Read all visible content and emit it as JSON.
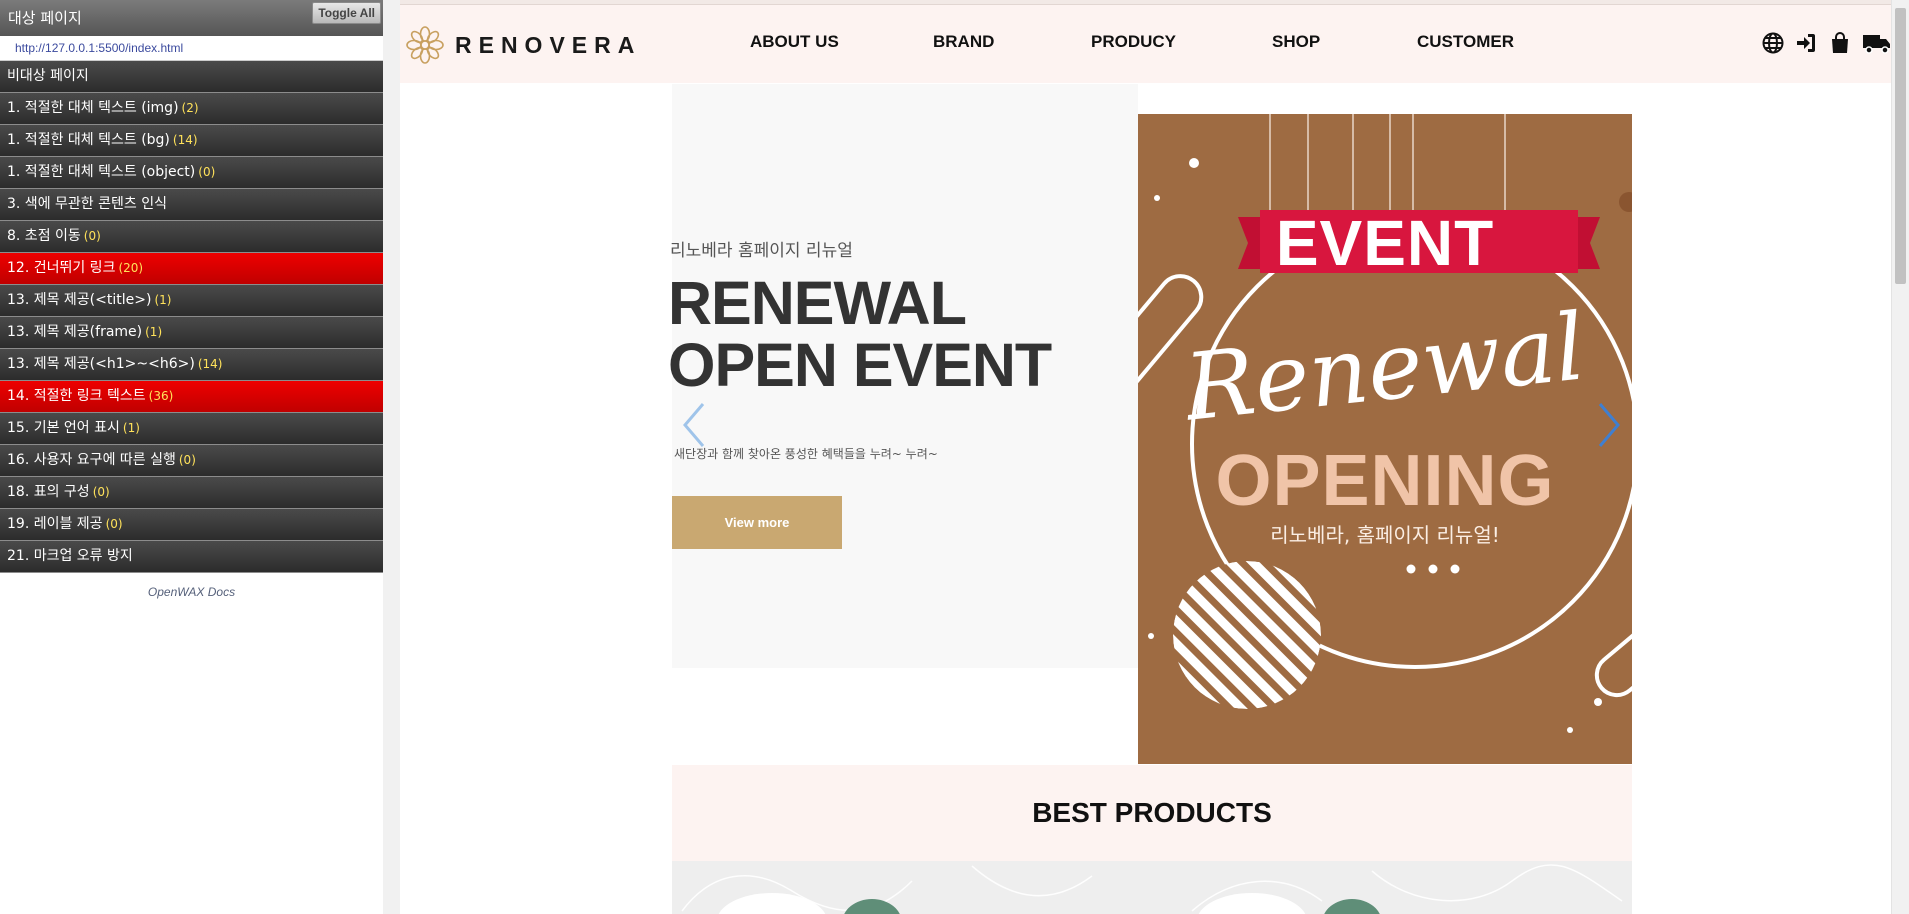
{
  "wax": {
    "target_page": "대상 페이지",
    "toggle_all": "Toggle All",
    "url": "http://127.0.0.1:5500/index.html",
    "non_target_page": "비대상 페이지",
    "items": [
      {
        "label": "1. 적절한 대체 텍스트 (img)",
        "count": "(2)",
        "highlight": false
      },
      {
        "label": "1. 적절한 대체 텍스트 (bg)",
        "count": "(14)",
        "highlight": false
      },
      {
        "label": "1. 적절한 대체 텍스트 (object)",
        "count": "(0)",
        "highlight": false
      },
      {
        "label": "3. 색에 무관한 콘텐츠 인식",
        "count": "",
        "highlight": false
      },
      {
        "label": "8. 초점 이동",
        "count": "(0)",
        "highlight": false
      },
      {
        "label": "12. 건너뛰기 링크",
        "count": "(20)",
        "highlight": true
      },
      {
        "label": "13. 제목 제공(<title>)",
        "count": "(1)",
        "highlight": false
      },
      {
        "label": "13. 제목 제공(frame)",
        "count": "(1)",
        "highlight": false
      },
      {
        "label": "13. 제목 제공(<h1>~<h6>)",
        "count": "(14)",
        "highlight": false
      },
      {
        "label": "14. 적절한 링크 텍스트",
        "count": "(36)",
        "highlight": true
      },
      {
        "label": "15. 기본 언어 표시",
        "count": "(1)",
        "highlight": false
      },
      {
        "label": "16. 사용자 요구에 따른 실행",
        "count": "(0)",
        "highlight": false
      },
      {
        "label": "18. 표의 구성",
        "count": "(0)",
        "highlight": false
      },
      {
        "label": "19. 레이블 제공",
        "count": "(0)",
        "highlight": false
      },
      {
        "label": "21. 마크업 오류 방지",
        "count": "",
        "highlight": false
      }
    ],
    "docs": "OpenWAX Docs"
  },
  "site": {
    "logo_text": "RENOVERA",
    "nav": [
      "ABOUT US",
      "BRAND",
      "PRODUCY",
      "SHOP",
      "CUSTOMER"
    ],
    "icons": [
      "globe-icon",
      "login-icon",
      "shopping-bag-icon",
      "truck-icon"
    ],
    "hero": {
      "subtitle": "리노베라 홈페이지 리뉴얼",
      "title_line1": "RENEWAL",
      "title_line2": "OPEN EVENT",
      "description": "새단장과 함께 찾아온 풍성한 혜택들을 누려~ 누려~",
      "button": "View more"
    },
    "event_banner": {
      "event": "EVENT",
      "script": "Renewal",
      "opening": "OPENING",
      "korean": "리노베라, 홈페이지 리뉴얼!"
    },
    "best_products": "BEST PRODUCTS"
  },
  "colors": {
    "panel_row": "#3a3a3a",
    "panel_highlight": "#d90000",
    "header_bg": "#fdf3f1",
    "button_gold": "#c9a871",
    "event_bg": "#9e6b42",
    "ribbon_red": "#d8163e",
    "opening_peach": "#f0c4a8"
  }
}
